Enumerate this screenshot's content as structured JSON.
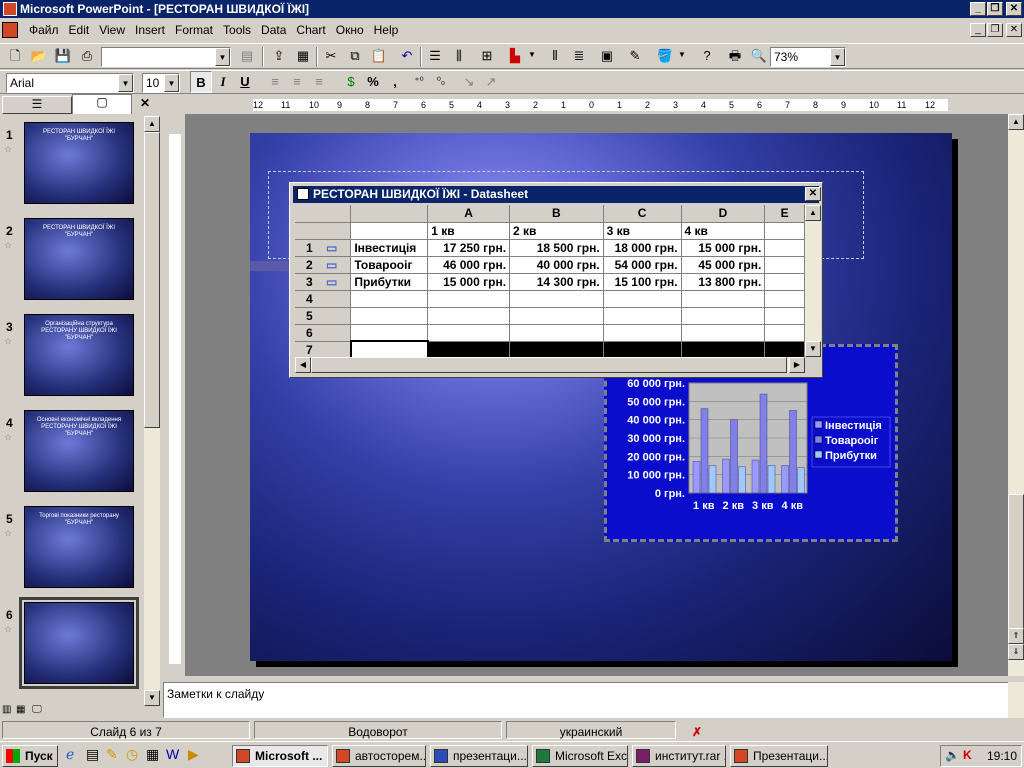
{
  "window": {
    "title": "Microsoft PowerPoint - [РЕСТОРАН ШВИДКОЇ ЇЖІ]"
  },
  "menu": [
    "Файл",
    "Edit",
    "View",
    "Insert",
    "Format",
    "Tools",
    "Data",
    "Chart",
    "Окно",
    "Help"
  ],
  "toolbar": {
    "zoom": "73%",
    "font": "Arial",
    "size": "10",
    "percent": "%",
    "comma": ","
  },
  "slides": [
    {
      "num": "1",
      "title": "РЕСТОРАН ШВИДКОЇ ЇЖІ \"БУРЧАН\""
    },
    {
      "num": "2",
      "title": "РЕСТОРАН ШВИДКОЇ ЇЖІ \"БУРЧАН\""
    },
    {
      "num": "3",
      "title": "Організаційна структура РЕСТОРАНУ ШВИДКОЇ ЇЖІ \"БУРЧАН\""
    },
    {
      "num": "4",
      "title": "Основні економічні вкладення РЕСТОРАНУ ШВИДКОЇ ЇЖІ \"БУРЧАН\""
    },
    {
      "num": "5",
      "title": "Торгові показники ресторану \"БУРЧАН\""
    },
    {
      "num": "6",
      "title": ""
    }
  ],
  "datasheet": {
    "title": "РЕСТОРАН ШВИДКОЇ ЇЖІ - Datasheet",
    "columns": [
      "A",
      "B",
      "C",
      "D",
      "E"
    ],
    "header_row": [
      "1 кв",
      "2 кв",
      "3 кв",
      "4 кв"
    ],
    "rows": [
      {
        "n": "1",
        "label": "Інвестиція",
        "values": [
          "17 250 грн.",
          "18 500 грн.",
          "18 000 грн.",
          "15 000 грн."
        ]
      },
      {
        "n": "2",
        "label": "Товарооіг",
        "values": [
          "46 000 грн.",
          "40 000 грн.",
          "54 000 грн.",
          "45 000 грн."
        ]
      },
      {
        "n": "3",
        "label": "Прибутки",
        "values": [
          "15 000 грн.",
          "14 300 грн.",
          "15 100 грн.",
          "13 800 грн."
        ]
      },
      {
        "n": "4",
        "label": "",
        "values": [
          "",
          "",
          "",
          ""
        ]
      },
      {
        "n": "5",
        "label": "",
        "values": [
          "",
          "",
          "",
          ""
        ]
      },
      {
        "n": "6",
        "label": "",
        "values": [
          "",
          "",
          "",
          ""
        ]
      },
      {
        "n": "7",
        "label": "",
        "values": [
          "",
          "",
          "",
          ""
        ]
      }
    ]
  },
  "chart_data": {
    "type": "bar",
    "categories": [
      "1 кв",
      "2 кв",
      "3 кв",
      "4 кв"
    ],
    "series": [
      {
        "name": "Інвестиція",
        "values": [
          17250,
          18500,
          18000,
          15000
        ],
        "color": "#9999ff"
      },
      {
        "name": "Товарооіг",
        "values": [
          46000,
          40000,
          54000,
          45000
        ],
        "color": "#8080e8"
      },
      {
        "name": "Прибутки",
        "values": [
          15000,
          14300,
          15100,
          13800
        ],
        "color": "#a0c8ff"
      }
    ],
    "yticks": [
      "0 грн.",
      "10 000 грн.",
      "20 000 грн.",
      "30 000 грн.",
      "40 000 грн.",
      "50 000 грн.",
      "60 000 грн."
    ],
    "ylim": [
      0,
      60000
    ],
    "legend": "right"
  },
  "notes": {
    "placeholder": "Заметки к слайду"
  },
  "status": {
    "slide": "Слайд 6 из 7",
    "design": "Водоворот",
    "lang": "украинский"
  },
  "taskbar": {
    "start": "Пуск",
    "time": "19:10",
    "tasks": [
      "Microsoft ...",
      "автосторем...",
      "презентаци...",
      "Microsoft Excel",
      "институт.rar ...",
      "Презентаци..."
    ]
  }
}
